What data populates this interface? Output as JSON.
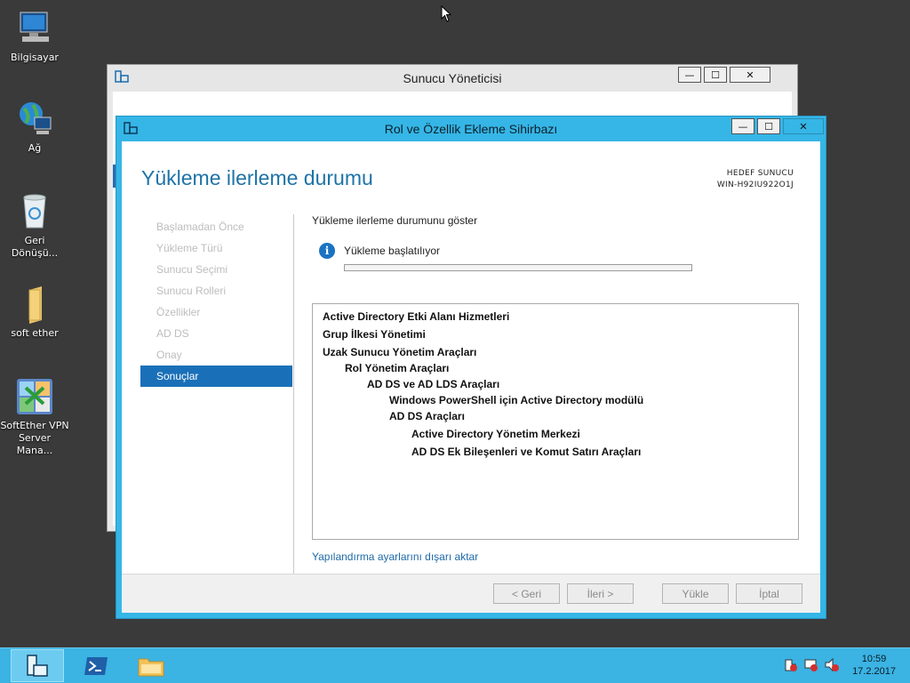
{
  "desktop": {
    "icons": [
      {
        "label": "Bilgisayar"
      },
      {
        "label": "Ağ"
      },
      {
        "label": "Geri Dönüşü..."
      },
      {
        "label": "soft ether"
      },
      {
        "label": "SoftEther VPN Server Mana..."
      }
    ]
  },
  "background_window": {
    "title": "Sunucu Yöneticisi",
    "controls": {
      "minimize": "—",
      "maximize": "☐",
      "close": "✕"
    }
  },
  "wizard": {
    "title": "Rol ve Özellik Ekleme Sihirbazı",
    "controls": {
      "minimize": "—",
      "maximize": "☐",
      "close": "✕"
    },
    "heading": "Yükleme ilerleme durumu",
    "target_label": "HEDEF SUNUCU",
    "target_server": "WIN-H92IU922O1J",
    "steps": [
      {
        "label": "Başlamadan Önce"
      },
      {
        "label": "Yükleme Türü"
      },
      {
        "label": "Sunucu Seçimi"
      },
      {
        "label": "Sunucu Rolleri"
      },
      {
        "label": "Özellikler"
      },
      {
        "label": "AD DS"
      },
      {
        "label": "Onay"
      },
      {
        "label": "Sonuçlar"
      }
    ],
    "active_step": 7,
    "caption": "Yükleme ilerleme durumunu göster",
    "status_text": "Yükleme başlatılıyor",
    "progress": 0,
    "features": [
      {
        "label": "Active Directory Etki Alanı Hizmetleri",
        "level": 0
      },
      {
        "label": "Grup İlkesi Yönetimi",
        "level": 0
      },
      {
        "label": "Uzak Sunucu Yönetim Araçları",
        "level": 0
      },
      {
        "label": "Rol Yönetim Araçları",
        "level": 1
      },
      {
        "label": "AD DS ve AD LDS Araçları",
        "level": 2
      },
      {
        "label": "Windows PowerShell için Active Directory modülü",
        "level": 3
      },
      {
        "label": "AD DS Araçları",
        "level": 3
      },
      {
        "label": "Active Directory Yönetim Merkezi",
        "level": 4
      },
      {
        "label": "AD DS Ek Bileşenleri ve Komut Satırı Araçları",
        "level": 4
      }
    ],
    "export_link": "Yapılandırma ayarlarını dışarı aktar",
    "buttons": {
      "back": "< Geri",
      "next": "İleri >",
      "install": "Yükle",
      "cancel": "İptal"
    }
  },
  "taskbar": {
    "time": "10:59",
    "date": "17.2.2017"
  }
}
